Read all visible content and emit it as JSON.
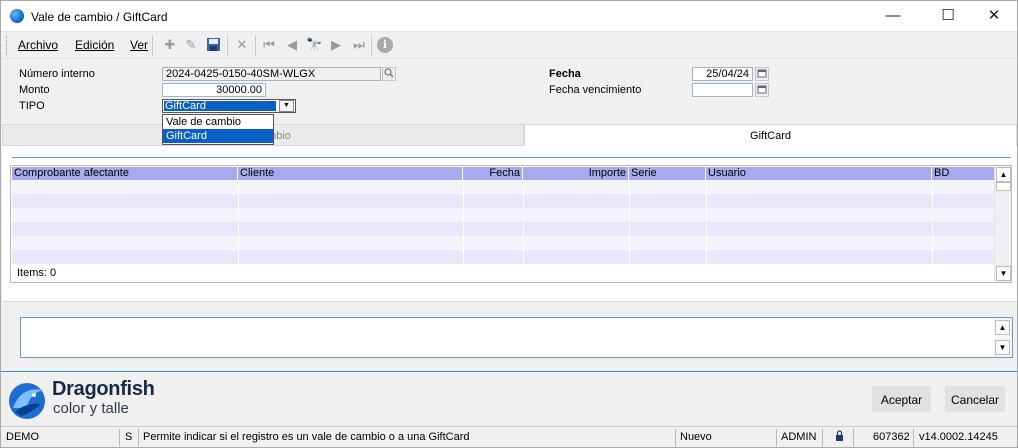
{
  "window": {
    "title": "Vale de cambio / GiftCard",
    "minimize": "—",
    "maximize": "☐",
    "close": "✕"
  },
  "menu": {
    "archivo": "Archivo",
    "edicion": "Edición",
    "ver": "Ver"
  },
  "toolbar": {
    "new": "✚",
    "edit": "✎",
    "save": "💾",
    "delete": "✕",
    "first": "⏮",
    "prev": "◀",
    "search": "🔭",
    "next": "▶",
    "last": "⏭",
    "info": "ℹ"
  },
  "form": {
    "numero_label": "Número interno",
    "numero_value": "2024-0425-0150-40SM-WLGX",
    "monto_label": "Monto",
    "monto_value": "30000.00",
    "tipo_label": "TIPO",
    "tipo_value": "GiftCard",
    "tipo_options": [
      "Vale de cambio",
      "GiftCard"
    ],
    "fecha_label": "Fecha",
    "fecha_value": "25/04/24",
    "venc_label": "Fecha vencimiento",
    "venc_value": ""
  },
  "tabs": {
    "tab1": "mbio",
    "tab2": "GiftCard"
  },
  "grid": {
    "columns": [
      "Comprobante afectante",
      "Cliente",
      "Fecha",
      "Importe",
      "Serie",
      "Usuario",
      "BD"
    ],
    "items_label": "Items: 0"
  },
  "brand": {
    "name": "Dragonfish",
    "tagline": "color y talle"
  },
  "buttons": {
    "accept": "Aceptar",
    "cancel": "Cancelar"
  },
  "status": {
    "db": "DEMO",
    "flag": "S",
    "hint": "Permite indicar si el registro es un vale de cambio o a una GiftCard",
    "mode": "Nuevo",
    "user": "ADMIN",
    "code": "607362",
    "version": "v14.0002.14245"
  },
  "colors": {
    "accent": "#0a5fc4",
    "grid_header": "#a9a9ef",
    "grid_row": "#e8e8fa",
    "footer_line": "#3a8fd9"
  }
}
